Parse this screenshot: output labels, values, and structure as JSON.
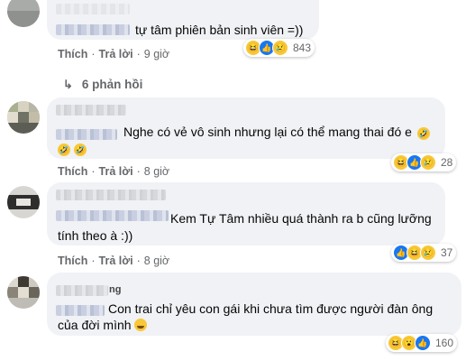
{
  "comments": [
    {
      "text": "tự tâm phiên bản sinh viên =))",
      "like": "Thích",
      "reply": "Trả lời",
      "time": "9 giờ",
      "reaction_count": "843",
      "reactions": [
        "haha-icon",
        "like-icon",
        "sad-icon"
      ]
    },
    {
      "text_line1": "Nghe có vẻ vô sinh nhưng lại có thể mang thai đó e",
      "like": "Thích",
      "reply": "Trả lời",
      "time": "8 giờ",
      "reaction_count": "28",
      "reactions": [
        "haha-icon",
        "like-icon",
        "sad-icon"
      ]
    },
    {
      "text_line1": "Kem Tự Tâm nhiều quá thành ra b cũng lưỡng",
      "text_line2": "tính theo à :))",
      "like": "Thích",
      "reply": "Trả lời",
      "time": "8 giờ",
      "reaction_count": "37",
      "reactions": [
        "like-icon",
        "haha-icon",
        "sad-icon"
      ]
    },
    {
      "name_visible": "ng",
      "text_line1": "Con trai chỉ yêu con gái khi chưa tìm được người đàn ông",
      "text_line2": "của đời mình",
      "like": "Thích",
      "reply": "Trả lời",
      "time": "8 giờ",
      "reaction_count": "160",
      "reactions": [
        "haha-icon",
        "wow-icon",
        "like-icon"
      ]
    }
  ],
  "replies_link": "6 phản hồi",
  "colors": {
    "bubble": "#f0f2f5",
    "meta": "#65676b",
    "like_blue": "#1877f2",
    "emoji_yellow": "#f7c838"
  }
}
